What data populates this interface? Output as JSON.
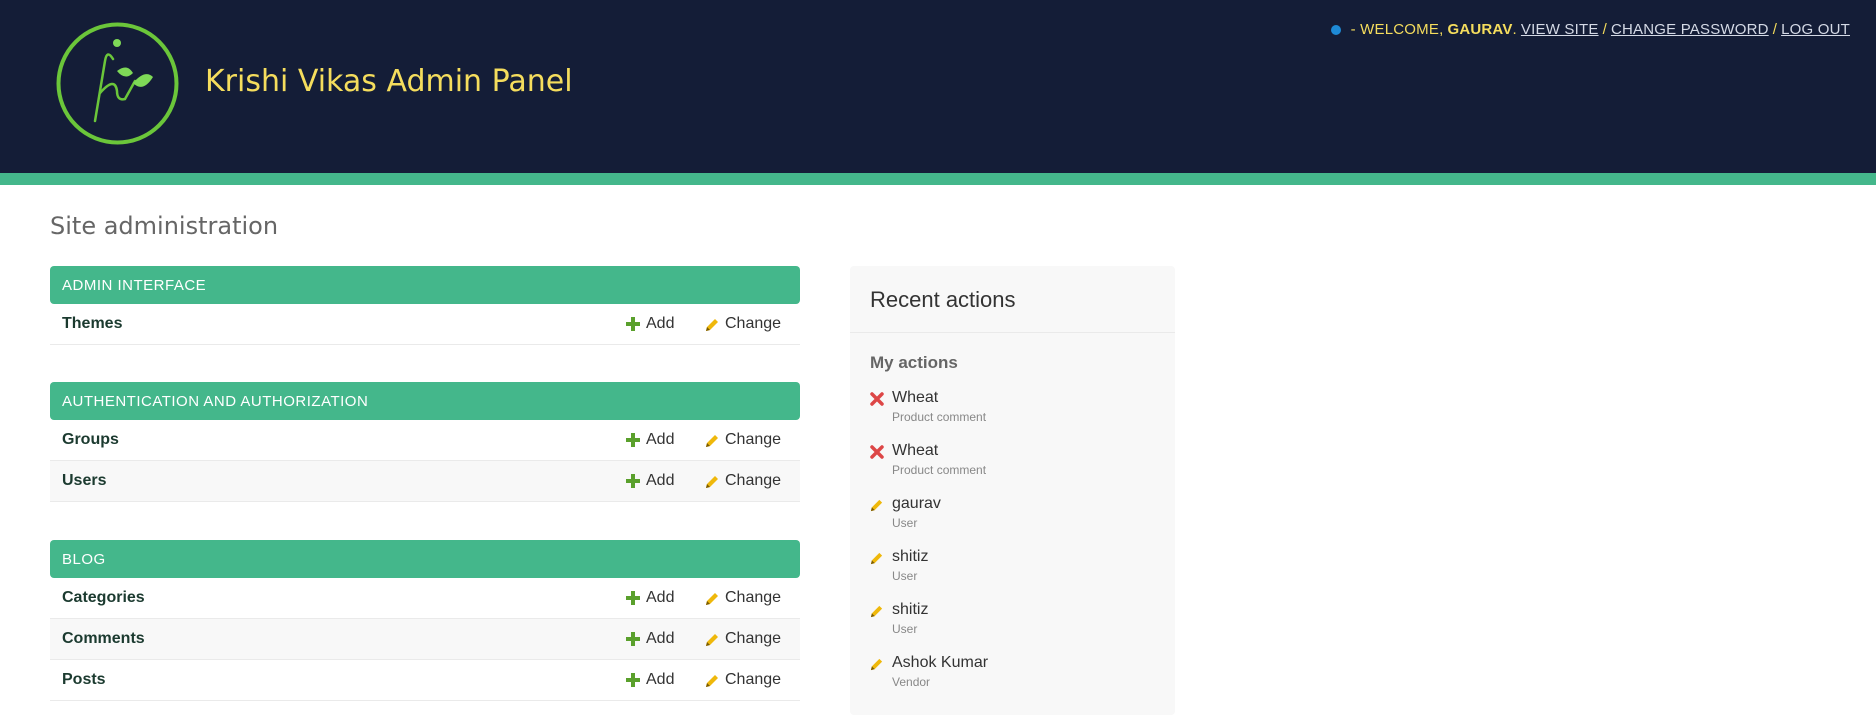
{
  "header": {
    "brand": "Krishi Vikas Admin Panel",
    "logo_name": "krishi-vikas-logo",
    "user_tools": {
      "welcome": "- WELCOME,",
      "username": "GAURAV",
      "period": ".",
      "view_site": "VIEW SITE",
      "change_password": "CHANGE PASSWORD",
      "log_out": "LOG OUT",
      "separator": "/"
    },
    "colors": {
      "background": "#141d37",
      "stripe": "#44b78b",
      "accent_text": "#f5dd5d",
      "status_dot": "#1e8ad6"
    }
  },
  "page_title": "Site administration",
  "modules": [
    {
      "caption": "ADMIN INTERFACE",
      "models": [
        {
          "name": "Themes",
          "add": "Add",
          "change": "Change"
        }
      ]
    },
    {
      "caption": "AUTHENTICATION AND AUTHORIZATION",
      "models": [
        {
          "name": "Groups",
          "add": "Add",
          "change": "Change"
        },
        {
          "name": "Users",
          "add": "Add",
          "change": "Change"
        }
      ]
    },
    {
      "caption": "BLOG",
      "models": [
        {
          "name": "Categories",
          "add": "Add",
          "change": "Change"
        },
        {
          "name": "Comments",
          "add": "Add",
          "change": "Change"
        },
        {
          "name": "Posts",
          "add": "Add",
          "change": "Change"
        }
      ]
    }
  ],
  "recent_actions": {
    "title": "Recent actions",
    "subtitle": "My actions",
    "items": [
      {
        "icon": "delete-icon",
        "object": "Wheat",
        "type": "Product comment"
      },
      {
        "icon": "delete-icon",
        "object": "Wheat",
        "type": "Product comment"
      },
      {
        "icon": "pencil-icon",
        "object": "gaurav",
        "type": "User"
      },
      {
        "icon": "pencil-icon",
        "object": "shitiz",
        "type": "User"
      },
      {
        "icon": "pencil-icon",
        "object": "shitiz",
        "type": "User"
      },
      {
        "icon": "pencil-icon",
        "object": "Ashok Kumar",
        "type": "Vendor"
      }
    ]
  },
  "icons": {
    "add": "plus-icon",
    "change": "pencil-icon",
    "delete": "delete-icon"
  },
  "colors": {
    "module_caption": "#44b78b",
    "add_icon": "#5aa02c",
    "change_icon": "#efb80b",
    "delete_icon": "#dd4646"
  }
}
